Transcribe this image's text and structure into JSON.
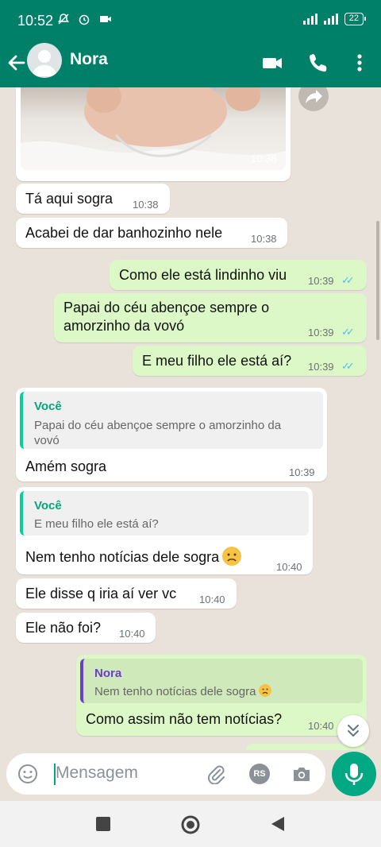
{
  "status_bar": {
    "time": "10:52",
    "battery": "22"
  },
  "header": {
    "contact_name": "Nora"
  },
  "messages": [
    {
      "id": "img",
      "time": "10:38"
    },
    {
      "id": "m1",
      "text": "Tá aqui sogra",
      "time": "10:38"
    },
    {
      "id": "m2",
      "text": "Acabei de dar banhozinho nele",
      "time": "10:38"
    },
    {
      "id": "m3",
      "text": "Como ele está lindinho viu",
      "time": "10:39"
    },
    {
      "id": "m4",
      "line1": "Papai do céu abençoe sempre o",
      "line2": "amorzinho da vovó",
      "time": "10:39"
    },
    {
      "id": "m5",
      "text": "E meu filho ele está aí?",
      "time": "10:39"
    },
    {
      "id": "m6",
      "quote_name": "Você",
      "quote_line1": "Papai do céu abençoe sempre o amorzinho da",
      "quote_line2": "vovó",
      "text": "Amém sogra",
      "time": "10:39"
    },
    {
      "id": "m7",
      "quote_name": "Você",
      "quote_text": "E meu filho ele está aí?",
      "text": "Nem tenho notícias dele sogra",
      "time": "10:40"
    },
    {
      "id": "m8",
      "text": "Ele disse q iria aí ver vc",
      "time": "10:40"
    },
    {
      "id": "m9",
      "text": "Ele não foi?",
      "time": "10:40"
    },
    {
      "id": "m10",
      "quote_name": "Nora",
      "quote_text": "Nem tenho notícias dele sogra",
      "text": "Como assim não tem notícias?",
      "time": "10:40"
    }
  ],
  "input": {
    "placeholder": "Mensagem",
    "rs_label": "RS"
  },
  "colors": {
    "header": "#008069",
    "outgoing": "#dcf8c6",
    "incoming": "#ffffff",
    "accent": "#00a884",
    "read_ticks": "#53bdeb"
  },
  "icons": [
    "back-arrow-icon",
    "video-call-icon",
    "phone-icon",
    "menu-dots-icon",
    "forward-icon",
    "emoji-icon",
    "attach-icon",
    "camera-icon",
    "mic-icon",
    "scroll-down-icon"
  ]
}
